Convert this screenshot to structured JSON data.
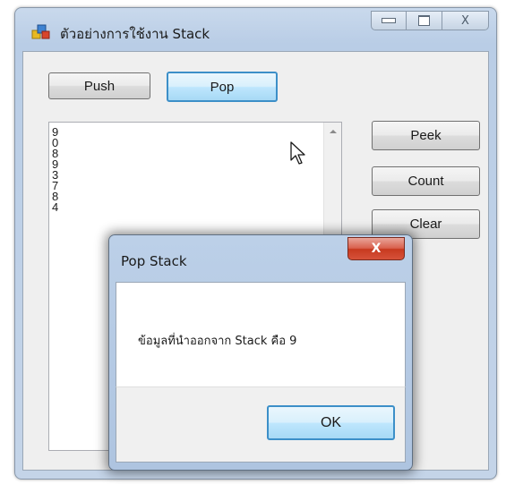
{
  "window": {
    "title": "ตัวอย่างการใช้งาน Stack",
    "maximize_glyph": "",
    "close_glyph": "X"
  },
  "buttons": {
    "push": "Push",
    "pop": "Pop",
    "peek": "Peek",
    "count": "Count",
    "clear": "Clear"
  },
  "listbox": {
    "items": [
      "9",
      "0",
      "8",
      "9",
      "3",
      "7",
      "8",
      "4"
    ]
  },
  "dialog": {
    "title": "Pop Stack",
    "close_glyph": "X",
    "message": "ข้อมูลที่นำออกจาก Stack คือ 9",
    "ok_label": "OK"
  },
  "colors": {
    "focus_border": "#3c8fc8",
    "close_button": "#c7391f",
    "window_frame": "#b9cde6"
  }
}
